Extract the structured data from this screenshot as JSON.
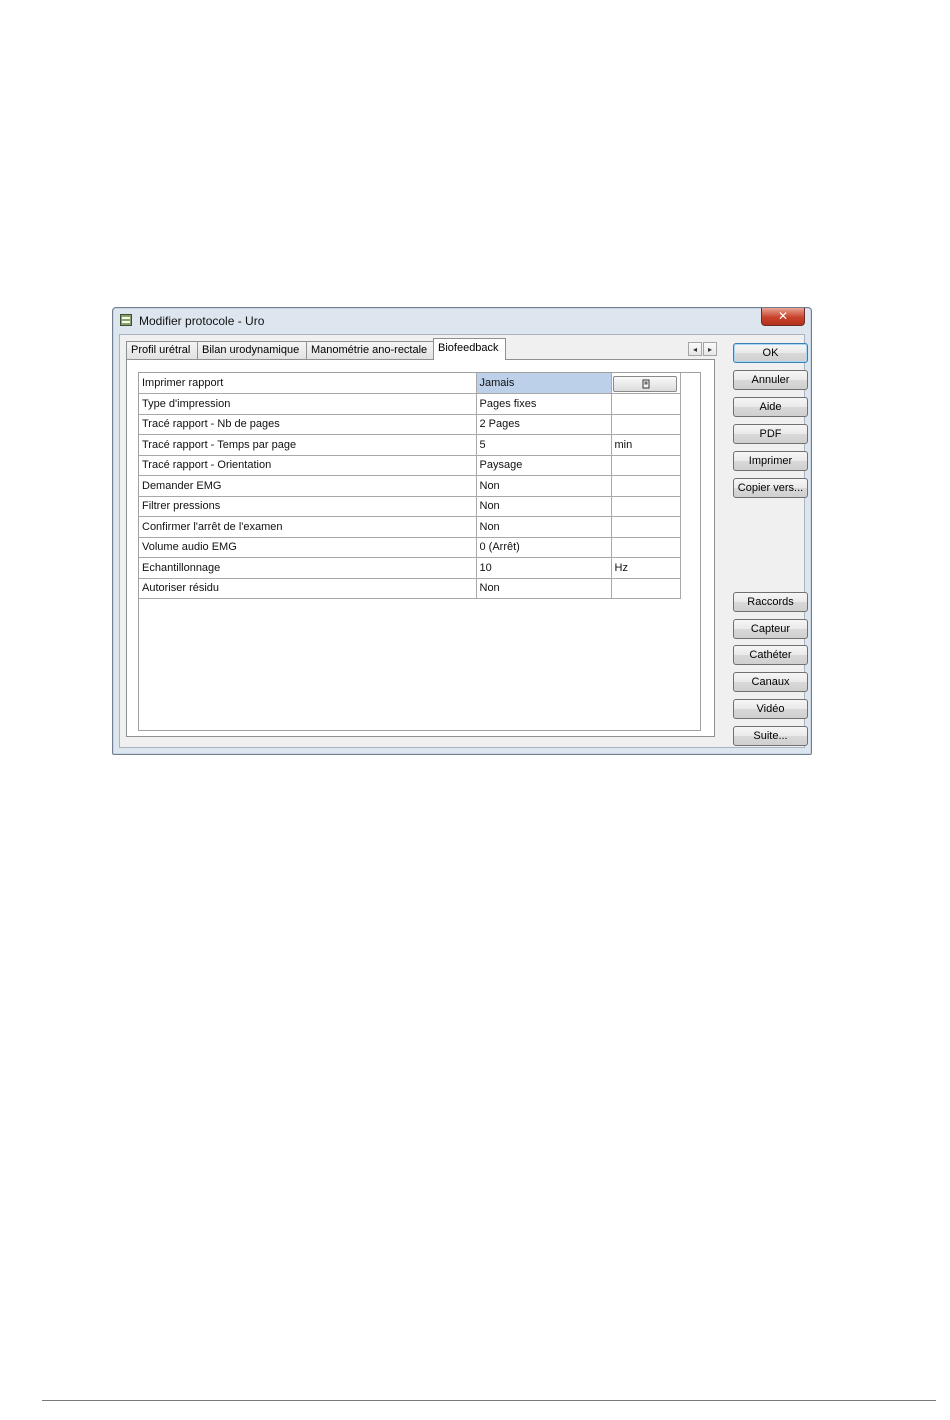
{
  "window": {
    "title": "Modifier protocole - Uro",
    "close_glyph": "✕"
  },
  "tabs": [
    {
      "label": "Profil urétral",
      "active": false
    },
    {
      "label": "Bilan urodynamique",
      "active": false
    },
    {
      "label": "Manométrie ano-rectale",
      "active": false
    },
    {
      "label": "Biofeedback",
      "active": true
    }
  ],
  "tab_scroll": {
    "left": "◂",
    "right": "▸"
  },
  "table": {
    "rows": [
      {
        "label": "Imprimer rapport",
        "value": "Jamais",
        "unit": "",
        "selected": true,
        "button_icon": "device-icon"
      },
      {
        "label": "Type d'impression",
        "value": "Pages fixes",
        "unit": ""
      },
      {
        "label": "Tracé rapport - Nb de pages",
        "value": "2 Pages",
        "unit": ""
      },
      {
        "label": "Tracé rapport - Temps par page",
        "value": "5",
        "unit": "min"
      },
      {
        "label": "Tracé rapport - Orientation",
        "value": "Paysage",
        "unit": ""
      },
      {
        "label": "Demander EMG",
        "value": "Non",
        "unit": ""
      },
      {
        "label": "Filtrer pressions",
        "value": "Non",
        "unit": ""
      },
      {
        "label": "Confirmer l'arrêt de l'examen",
        "value": "Non",
        "unit": ""
      },
      {
        "label": "Volume audio EMG",
        "value": "0 (Arrêt)",
        "unit": ""
      },
      {
        "label": "Echantillonnage",
        "value": "10",
        "unit": "Hz"
      },
      {
        "label": "Autoriser résidu",
        "value": "Non",
        "unit": ""
      }
    ]
  },
  "buttons": {
    "ok": "OK",
    "annuler": "Annuler",
    "aide": "Aide",
    "pdf": "PDF",
    "imprimer": "Imprimer",
    "copier": "Copier vers...",
    "raccords": "Raccords",
    "capteur": "Capteur",
    "catheter": "Cathéter",
    "canaux": "Canaux",
    "video": "Vidéo",
    "suite": "Suite..."
  },
  "colors": {
    "selection": "#bcd0ea",
    "close_button": "#c8422b",
    "window_frame": "#dde6ef"
  }
}
